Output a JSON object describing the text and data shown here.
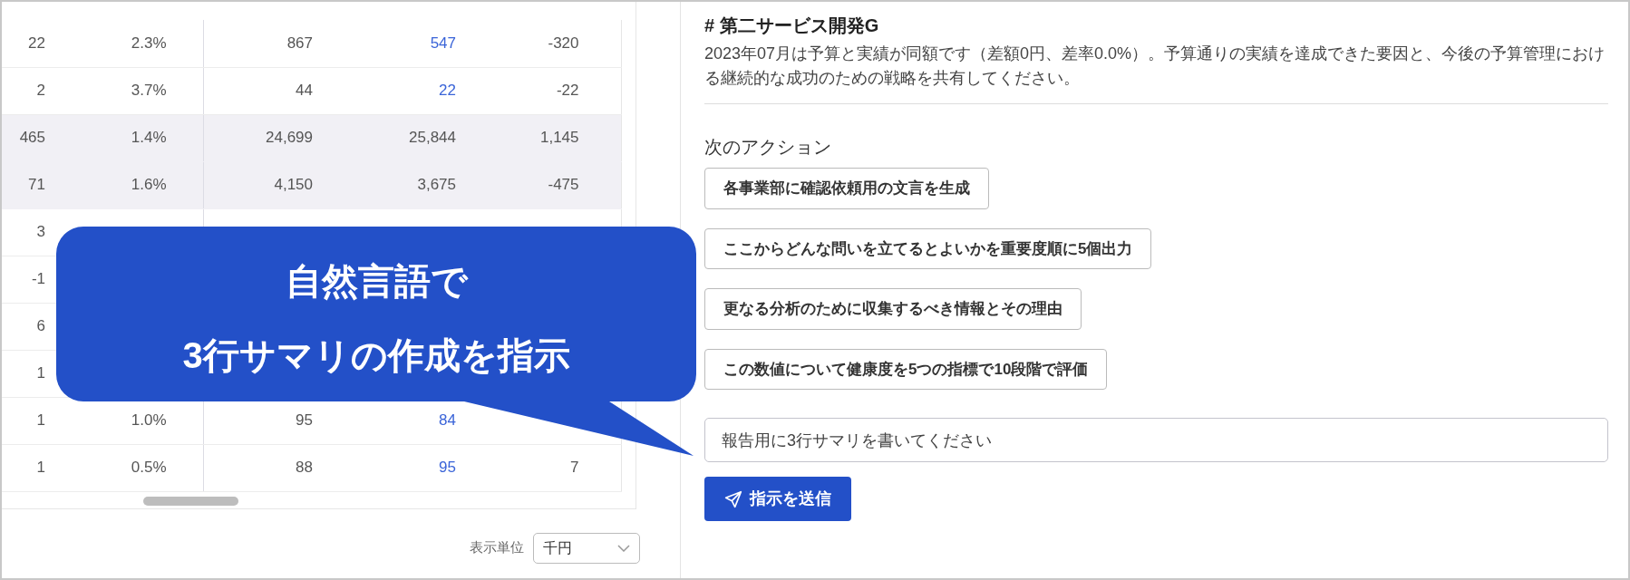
{
  "table": {
    "rows": [
      {
        "cells": [
          "22",
          "2.3%",
          "867",
          "547",
          "-320"
        ],
        "highlighted": false,
        "linked": true
      },
      {
        "cells": [
          "2",
          "3.7%",
          "44",
          "22",
          "-22"
        ],
        "highlighted": false,
        "linked": true
      },
      {
        "cells": [
          "465",
          "1.4%",
          "24,699",
          "25,844",
          "1,145"
        ],
        "highlighted": true,
        "linked": false
      },
      {
        "cells": [
          "71",
          "1.6%",
          "4,150",
          "3,675",
          "-475"
        ],
        "highlighted": true,
        "linked": false
      },
      {
        "cells": [
          "3"
        ],
        "highlighted": false
      },
      {
        "cells": [
          "-1"
        ],
        "highlighted": false
      },
      {
        "cells": [
          "6"
        ],
        "highlighted": false
      },
      {
        "cells": [
          "1"
        ],
        "highlighted": false
      },
      {
        "cells": [
          "1",
          "1.0%",
          "95",
          "84"
        ],
        "highlighted": false,
        "linked": true
      },
      {
        "cells": [
          "1",
          "0.5%",
          "88",
          "95",
          "7"
        ],
        "highlighted": false,
        "linked": true
      }
    ]
  },
  "unit_selector": {
    "label": "表示単位",
    "value": "千円"
  },
  "detail": {
    "heading": "# 第二サービス開発G",
    "message": "2023年07月は予算と実績が同額です（差額0円、差率0.0%）。予算通りの実績を達成できた要因と、今後の予算管理における継続的な成功のための戦略を共有してください。",
    "actions_title": "次のアクション",
    "actions": [
      "各事業部に確認依頼用の文言を生成",
      "ここからどんな問いを立てるとよいかを重要度順に5個出力",
      "更なる分析のために収集するべき情報とその理由",
      "この数値について健康度を5つの指標で10段階で評価"
    ],
    "prompt": {
      "value": "報告用に3行サマリを書いてください"
    },
    "send_button": "指示を送信"
  },
  "callout": {
    "lines": [
      "自然言語で",
      "3行サマリの作成を指示"
    ]
  }
}
